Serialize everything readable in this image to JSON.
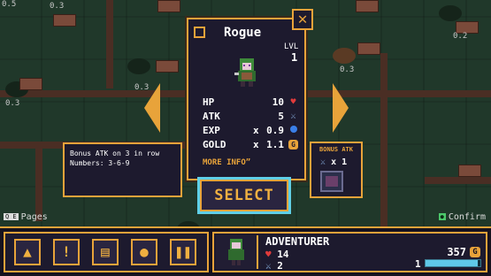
{
  "colors": {
    "accent": "#e8a33a",
    "panel": "#1d1a2e",
    "select_glow": "#5fd0e8",
    "heart": "#e23b3b",
    "exp_orb": "#3a7fe8",
    "confirm_key": "#4cc86b"
  },
  "map": {
    "counts": [
      "0.3",
      "0.2",
      "0.3",
      "0.3",
      "0.3",
      "0.5"
    ]
  },
  "character": {
    "name": "Rogue",
    "level_label": "LVL",
    "level": "1",
    "stats": [
      {
        "label": "HP",
        "multiplier": "",
        "value": "10",
        "icon": "heart-icon"
      },
      {
        "label": "ATK",
        "multiplier": "",
        "value": "5",
        "icon": "sword-icon"
      },
      {
        "label": "EXP",
        "multiplier": "x",
        "value": "0.9",
        "icon": "exp-orb-icon"
      },
      {
        "label": "GOLD",
        "multiplier": "x",
        "value": "1.1",
        "icon": "coin-icon"
      }
    ],
    "more_info": "MORE INFO"
  },
  "description": {
    "line1": "Bonus ATK on 3 in row",
    "line2": "Numbers: 3-6-9"
  },
  "bonus": {
    "title": "BONUS ATK",
    "count": "x 1"
  },
  "select_label": "SELECT",
  "hints": {
    "pages_key": "Q E",
    "pages": "Pages",
    "confirm": "Confirm"
  },
  "adventurer": {
    "title": "ADVENTURER",
    "hp": "14",
    "atk": "2",
    "gold": "357",
    "level": "1",
    "xp_fraction": 0.95
  }
}
